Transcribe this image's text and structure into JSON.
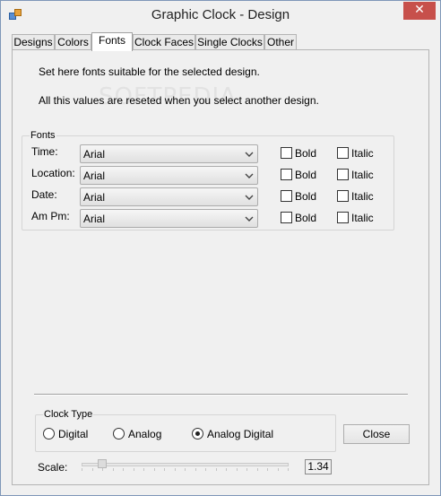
{
  "window": {
    "title": "Graphic Clock - Design",
    "close_glyph": "✕"
  },
  "tabs": [
    "Designs",
    "Colors",
    "Fonts",
    "Clock Faces",
    "Single Clocks",
    "Other"
  ],
  "active_tab": "Fonts",
  "info": {
    "line1": "Set here fonts suitable for the selected design.",
    "line2": "All this values are reseted when you select another design.",
    "watermark": "SOFTPEDIA"
  },
  "fonts_group": {
    "legend": "Fonts",
    "rows": [
      {
        "label": "Time:",
        "font": "Arial",
        "bold_label": "Bold",
        "italic_label": "Italic",
        "bold": false,
        "italic": false
      },
      {
        "label": "Location:",
        "font": "Arial",
        "bold_label": "Bold",
        "italic_label": "Italic",
        "bold": false,
        "italic": false
      },
      {
        "label": "Date:",
        "font": "Arial",
        "bold_label": "Bold",
        "italic_label": "Italic",
        "bold": false,
        "italic": false
      },
      {
        "label": "Am Pm:",
        "font": "Arial",
        "bold_label": "Bold",
        "italic_label": "Italic",
        "bold": false,
        "italic": false
      }
    ]
  },
  "clock_type": {
    "legend": "Clock Type",
    "options": [
      "Digital",
      "Analog",
      "Analog Digital"
    ],
    "selected": "Analog Digital"
  },
  "close_button": "Close",
  "scale": {
    "label": "Scale:",
    "value": "1.34"
  },
  "icons": {
    "app": "app-icon",
    "chevron": "chevron-down-icon"
  }
}
